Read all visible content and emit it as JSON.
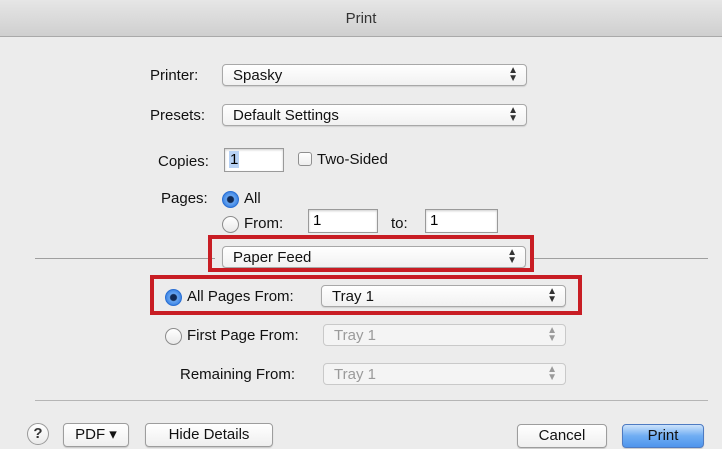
{
  "window": {
    "title": "Print"
  },
  "printer": {
    "label": "Printer:",
    "value": "Spasky"
  },
  "presets": {
    "label": "Presets:",
    "value": "Default Settings"
  },
  "copies": {
    "label": "Copies:",
    "value": "1",
    "two_sided_label": "Two-Sided",
    "two_sided_checked": false
  },
  "pages": {
    "label": "Pages:",
    "all_label": "All",
    "all_selected": true,
    "from_label": "From:",
    "from_value": "1",
    "to_label": "to:",
    "to_value": "1"
  },
  "section_popup": {
    "value": "Paper Feed"
  },
  "paper_feed": {
    "all_pages_from_label": "All Pages From:",
    "all_pages_from_value": "Tray 1",
    "all_pages_selected": true,
    "first_page_from_label": "First Page From:",
    "first_page_from_value": "Tray 1",
    "remaining_from_label": "Remaining From:",
    "remaining_from_value": "Tray 1"
  },
  "footer": {
    "help_symbol": "?",
    "pdf_label": "PDF ▾",
    "hide_details_label": "Hide Details",
    "cancel_label": "Cancel",
    "print_label": "Print"
  },
  "colors": {
    "highlight": "#c81d24",
    "accent": "#2f78dd"
  }
}
